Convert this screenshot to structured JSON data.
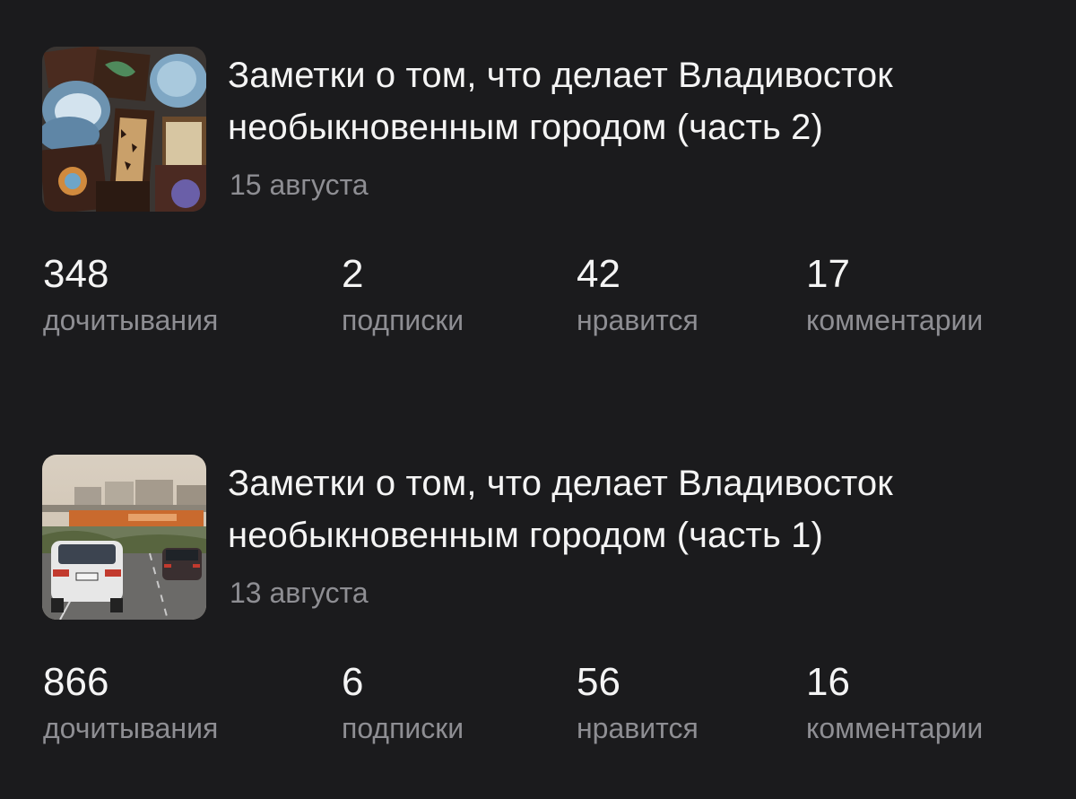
{
  "articles": [
    {
      "title_line1": "Заметки о том, что делает Владивосток",
      "title_line2": "необыкновенным городом (часть 2)",
      "date": "15 августа",
      "thumbnail": "chocolate-bars-photo",
      "stats": {
        "reads": {
          "value": "348",
          "label": "дочитывания"
        },
        "subscriptions": {
          "value": "2",
          "label": "подписки"
        },
        "likes": {
          "value": "42",
          "label": "нравится"
        },
        "comments": {
          "value": "17",
          "label": "комментарии"
        }
      }
    },
    {
      "title_line1": "Заметки о том, что делает Владивосток",
      "title_line2": "необыкновенным городом (часть 1)",
      "date": "13 августа",
      "thumbnail": "city-road-photo",
      "stats": {
        "reads": {
          "value": "866",
          "label": "дочитывания"
        },
        "subscriptions": {
          "value": "6",
          "label": "подписки"
        },
        "likes": {
          "value": "56",
          "label": "нравится"
        },
        "comments": {
          "value": "16",
          "label": "комментарии"
        }
      }
    }
  ],
  "colors": {
    "background": "#1b1b1d",
    "text_primary": "#f4f4f4",
    "text_secondary": "#8e8e93"
  }
}
